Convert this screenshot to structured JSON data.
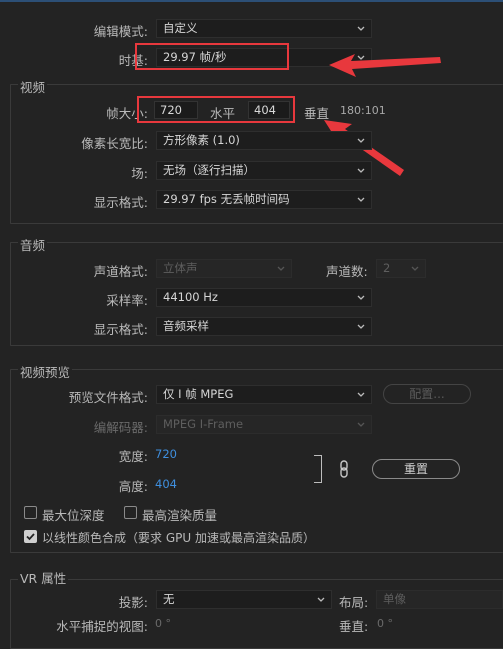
{
  "top": {
    "edit_mode_label": "编辑模式:",
    "edit_mode_value": "自定义",
    "timebase_label": "时基:",
    "timebase_value": "29.97 帧/秒"
  },
  "video": {
    "section_title": "视频",
    "frame_size_label": "帧大小:",
    "frame_width": "720",
    "horizontal_label": "水平",
    "frame_height": "404",
    "vertical_label": "垂直",
    "aspect_ratio": "180:101",
    "pixel_aspect_label": "像素长宽比:",
    "pixel_aspect_value": "方形像素 (1.0)",
    "field_label": "场:",
    "field_value": "无场（逐行扫描）",
    "display_format_label": "显示格式:",
    "display_format_value": "29.97 fps 无丢帧时间码"
  },
  "audio": {
    "section_title": "音频",
    "channel_format_label": "声道格式:",
    "channel_format_value": "立体声",
    "channel_count_label": "声道数:",
    "channel_count_value": "2",
    "sample_rate_label": "采样率:",
    "sample_rate_value": "44100 Hz",
    "display_format_label": "显示格式:",
    "display_format_value": "音频采样"
  },
  "preview": {
    "section_title": "视频预览",
    "file_format_label": "预览文件格式:",
    "file_format_value": "仅 I 帧 MPEG",
    "config_button": "配置...",
    "codec_label": "编解码器:",
    "codec_value": "MPEG I-Frame",
    "width_label": "宽度:",
    "width_value": "720",
    "height_label": "高度:",
    "height_value": "404",
    "reset_button": "重置",
    "max_depth_label": "最大位深度",
    "max_quality_label": "最高渲染质量",
    "linear_color_label": "以线性颜色合成（要求 GPU 加速或最高渲染品质）",
    "max_depth_checked": false,
    "max_quality_checked": false,
    "linear_color_checked": true
  },
  "vr": {
    "section_title": "VR 属性",
    "projection_label": "投影:",
    "projection_value": "无",
    "layout_label": "布局:",
    "layout_value": "单像",
    "h_fov_label": "水平捕捉的视图:",
    "h_fov_value": "0 °",
    "v_label": "垂直:",
    "v_value": "0 °"
  },
  "colors": {
    "annotation_red": "#e8383d",
    "link_blue": "#3f8fde",
    "background": "#232323"
  }
}
